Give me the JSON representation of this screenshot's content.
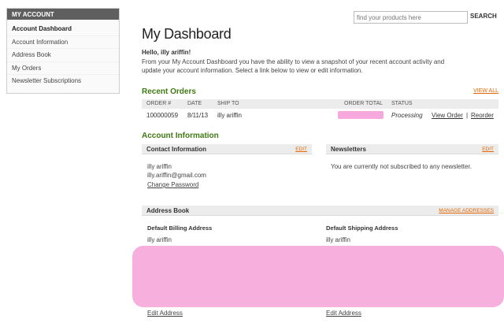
{
  "sidebar": {
    "title": "MY ACCOUNT",
    "items": [
      {
        "label": "Account Dashboard"
      },
      {
        "label": "Account Information"
      },
      {
        "label": "Address Book"
      },
      {
        "label": "My Orders"
      },
      {
        "label": "Newsletter Subscriptions"
      }
    ]
  },
  "search": {
    "placeholder": "find your products here",
    "button_label": "SEARCH"
  },
  "dashboard": {
    "title": "My Dashboard",
    "hello": "Hello, illy ariffin!",
    "intro": "From your My Account Dashboard you have the ability to view a snapshot of your recent account activity and update your account information. Select a link below to view or edit information."
  },
  "recent_orders": {
    "title": "Recent Orders",
    "view_all": "VIEW ALL",
    "columns": [
      "ORDER #",
      "DATE",
      "SHIP TO",
      "ORDER TOTAL",
      "STATUS"
    ],
    "rows": [
      {
        "order": "100000059",
        "date": "8/11/13",
        "ship_to": "illy ariffin",
        "status": "Processing",
        "view_order": "View Order",
        "separator": "|",
        "reorder": "Reorder"
      }
    ]
  },
  "account_info": {
    "title": "Account Information",
    "contact": {
      "header": "Contact Information",
      "edit": "EDIT",
      "name": "illy ariffin",
      "email": "illy.ariffin@gmail.com",
      "change_password": "Change Password"
    },
    "newsletters": {
      "header": "Newsletters",
      "edit": "EDIT",
      "text": "You are currently not subscribed to any newsletter."
    }
  },
  "address_book": {
    "header": "Address Book",
    "manage": "MANAGE ADDRESSES",
    "billing": {
      "title": "Default Billing Address",
      "name": "illy ariffin",
      "edit": "Edit Address"
    },
    "shipping": {
      "title": "Default Shipping Address",
      "name": "illy ariffin",
      "edit": "Edit Address"
    }
  },
  "colors": {
    "accent_green": "#3f7a12",
    "link_orange": "#e26703",
    "sidebar_header": "#5f5f5f",
    "redaction_pink": "#f7b0dd"
  }
}
